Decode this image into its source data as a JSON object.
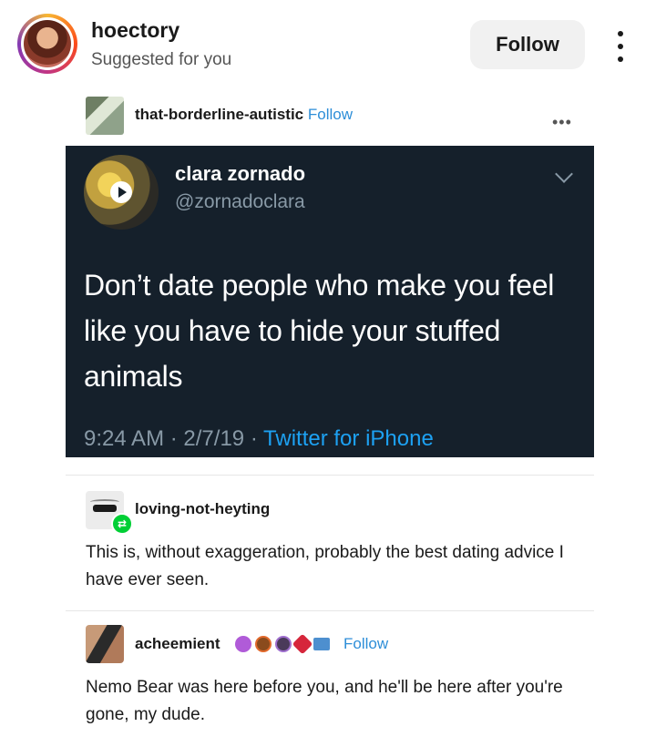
{
  "header": {
    "username": "hoectory",
    "subtitle": "Suggested for you",
    "follow_label": "Follow"
  },
  "reblog_source": {
    "blog_name": "that-borderline-autistic",
    "follow_label": "Follow",
    "more_glyph": "•••"
  },
  "tweet": {
    "display_name": "clara zornado",
    "handle": "@zornadoclara",
    "text": "Don’t date people who make you feel like you have to hide your stuffed animals",
    "time": "9:24 AM",
    "date": "2/7/19",
    "source": "Twitter for iPhone",
    "separator": "·",
    "colors": {
      "background": "#15202b",
      "text": "#ffffff",
      "muted": "#8899a6",
      "link": "#1da1f2"
    }
  },
  "comments": [
    {
      "blog_name": "loving-not-heyting",
      "text": "This is, without exaggeration, probably the best dating advice I have ever seen."
    },
    {
      "blog_name": "acheemient",
      "follow_label": "Follow",
      "text": "Nemo Bear was here before you, and he'll be here after you're gone, my dude."
    }
  ],
  "icons": {
    "kebab": "more-vertical-icon",
    "reblog": "reblog-icon",
    "badges": [
      "purple-badge-icon",
      "brown-badge-icon",
      "dark-badge-icon",
      "red-badge-icon",
      "blue-badge-icon"
    ]
  },
  "colors": {
    "accent_link": "#2d8ed8",
    "follow_button_bg": "#f1f1f1"
  }
}
